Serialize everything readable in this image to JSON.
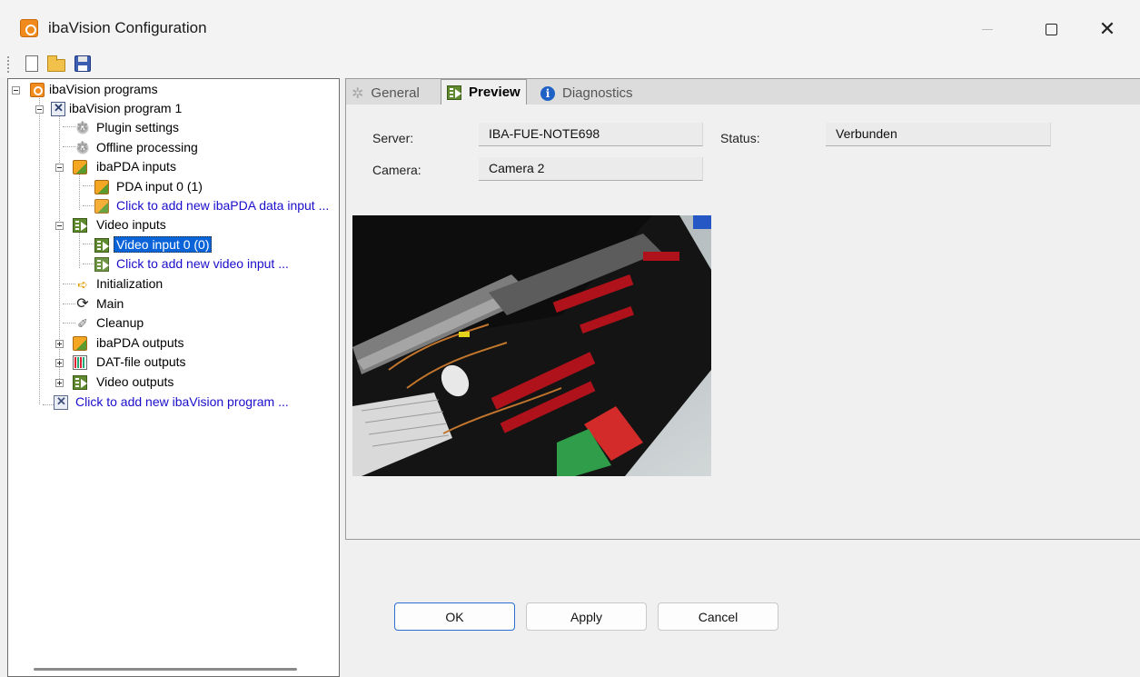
{
  "window": {
    "title": "ibaVision Configuration"
  },
  "tree": {
    "root": "ibaVision programs",
    "program": "ibaVision program 1",
    "plugin_settings": "Plugin settings",
    "offline_processing": "Offline processing",
    "pda_inputs": "ibaPDA inputs",
    "pda_input_0": "PDA input 0 (1)",
    "add_pda_input": "Click to add new ibaPDA data input ...",
    "video_inputs": "Video inputs",
    "video_input_0": "Video input 0 (0)",
    "add_video_input": "Click to add new video input ...",
    "initialization": "Initialization",
    "main": "Main",
    "cleanup": "Cleanup",
    "pda_outputs": "ibaPDA outputs",
    "dat_outputs": "DAT-file outputs",
    "video_outputs": "Video outputs",
    "add_program": "Click to add new ibaVision program ..."
  },
  "tabs": {
    "general": "General",
    "preview": "Preview",
    "diagnostics": "Diagnostics"
  },
  "form": {
    "server_label": "Server:",
    "server_value": "IBA-FUE-NOTE698",
    "status_label": "Status:",
    "status_value": "Verbunden",
    "camera_label": "Camera:",
    "camera_value": "Camera 2"
  },
  "buttons": {
    "ok": "OK",
    "apply": "Apply",
    "cancel": "Cancel"
  }
}
